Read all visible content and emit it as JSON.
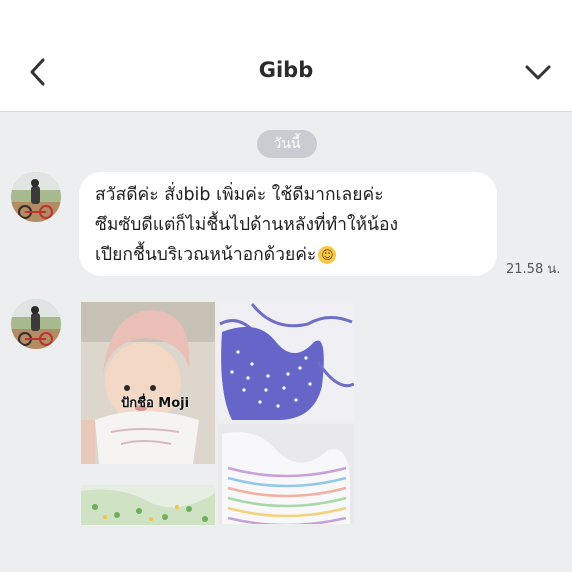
{
  "header": {
    "title": "Gibb",
    "back_icon": "chevron-left-icon",
    "menu_icon": "chevron-down-icon"
  },
  "chat": {
    "date_label": "วันนี้",
    "message": {
      "lines": [
        "สวัสดีค่ะ สั่งbib เพิ่มค่ะ ใช้ดีมากเลยค่ะ",
        "ซึมซับดีแต่ก็ไม่ชื้นไปด้านหลังที่ทำให้น้อง",
        "เปียกชื้นบริเวณหน้าอกด้วยค่ะ"
      ],
      "emoji": "☺",
      "time": "21.58 น."
    },
    "photo_caption": "ปักชื่อ Moji"
  },
  "colors": {
    "chat_background": "#eceef0",
    "bubble": "#ffffff",
    "date_pill": "#c9ccd1"
  }
}
